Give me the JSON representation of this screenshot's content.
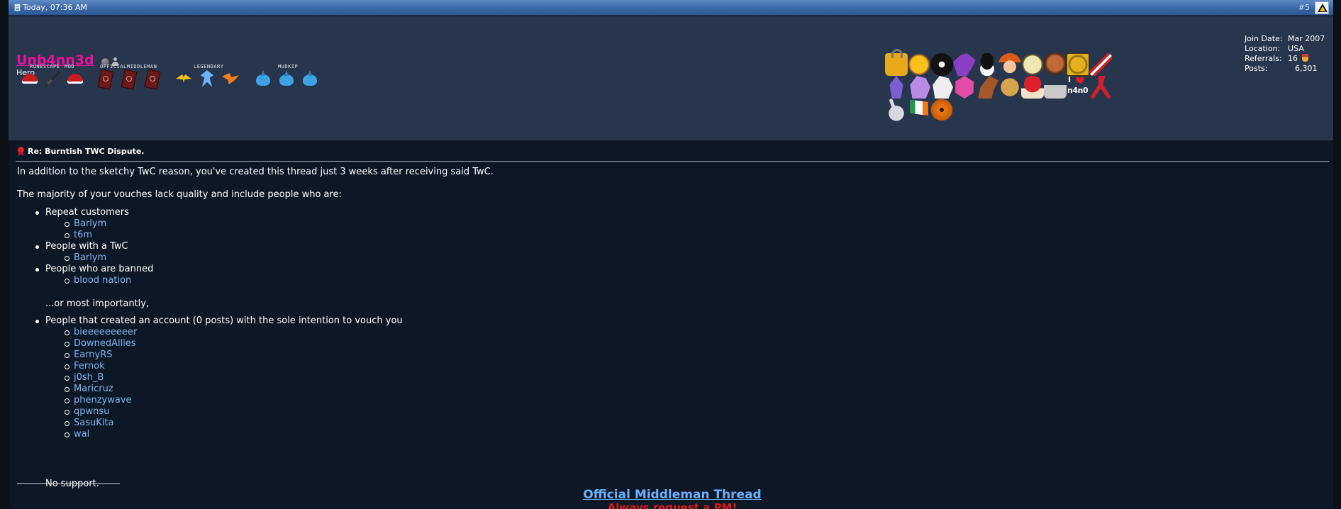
{
  "header": {
    "date": "Today, 07:36 AM",
    "post_number": "#5"
  },
  "user": {
    "name": "Unb4nn3d",
    "title": "Hero",
    "award_groups": [
      "Runescape",
      "Mod",
      "Official",
      "Middleman",
      "Legendary",
      "Mudkip"
    ],
    "stats": [
      {
        "label": "Join Date:",
        "value": "Mar 2007"
      },
      {
        "label": "Location:",
        "value": "USA"
      },
      {
        "label": "Referrals:",
        "value": "16"
      },
      {
        "label": "Posts:",
        "value": "6,301"
      }
    ],
    "badge_icons": [
      "lock-icon",
      "sun-icon",
      "eight-ball-icon",
      "dragon-icon",
      "heisenberg-icon",
      "fry-icon",
      "face-icon",
      "ape-icon",
      "lion-icon",
      "candy-cane-icon",
      "wizard-icon",
      "pony-icon",
      "white-pony-icon",
      "crystal-icon",
      "squirrel-icon",
      "doge-icon",
      "mushroom-icon",
      "castle-icon",
      "i-love-n4n0-icon",
      "ribbon-icon",
      "bunny-icon",
      "irish-flag-icon",
      "pumpkin-icon"
    ],
    "love_badge": {
      "top": "I",
      "bottom": "n4n0"
    }
  },
  "post": {
    "title": "Re: Burntish TWC Dispute.",
    "intro": "In addition to the sketchy TwC reason, you've created this thread just 3 weeks after receiving said TwC.",
    "lead": "The majority of your vouches lack quality and include people who are:",
    "groups": [
      {
        "label": "Repeat customers",
        "items": [
          "Barlym",
          "t6m"
        ]
      },
      {
        "label": "People with a TwC",
        "items": [
          "Barlym"
        ]
      },
      {
        "label": "People who are banned",
        "items": [
          "blood nation"
        ]
      }
    ],
    "bridge": "...or most importantly,",
    "last_group": {
      "label": "People that created an account (0 posts) with the sole intention to vouch you",
      "items": [
        "bieeeeeeeeer",
        "DownedAllies",
        "EarnyRS",
        "Fernok",
        "j0sh_B",
        "Maricruz",
        "phenzywave",
        "qpwnsu",
        "SasuKita",
        "wal"
      ]
    },
    "closing": "No support."
  },
  "signature": {
    "title": "Official Middleman Thread",
    "subtitle": "Always request a PM!"
  },
  "colors": {
    "username": "#e8129b",
    "link": "#7fb4f0",
    "signature_title": "#6cb0ff",
    "signature_sub": "#e01a1a",
    "header_bar": "#3a67a6",
    "userinfo_bg": "#27364d",
    "body_bg": "#0d1826"
  }
}
